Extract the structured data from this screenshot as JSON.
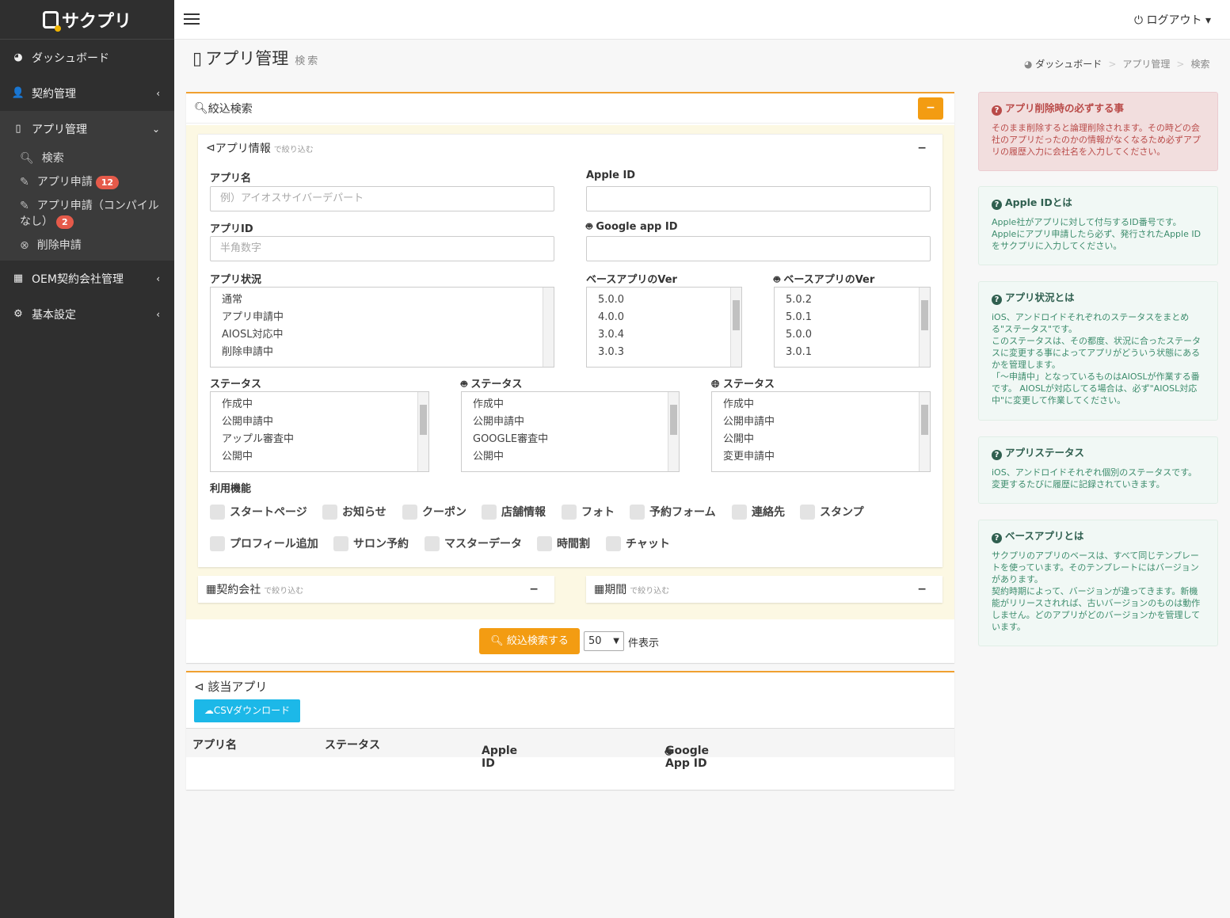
{
  "app": {
    "logo_text": "サクプリ"
  },
  "sidebar": {
    "items": [
      {
        "label": "ダッシュボード",
        "icon": "dashboard-icon"
      },
      {
        "label": "契約管理",
        "icon": "user-icon"
      },
      {
        "label": "アプリ管理",
        "icon": "mobile-icon"
      },
      {
        "label": "OEM契約会社管理",
        "icon": "building-icon"
      },
      {
        "label": "基本設定",
        "icon": "cogs-icon"
      }
    ],
    "sub_items": [
      {
        "label": "検索",
        "icon": "search-icon"
      },
      {
        "label": "アプリ申請",
        "badge": "12",
        "icon": "edit-icon"
      },
      {
        "label": "アプリ申請（コンパイルなし）",
        "badge": "2",
        "icon": "edit-icon"
      },
      {
        "label": "削除申請",
        "icon": "times-circle-icon"
      }
    ]
  },
  "topbar": {
    "logout": "ログアウト"
  },
  "page": {
    "title": "アプリ管理",
    "subtitle": "検索"
  },
  "breadcrumb": [
    "ダッシュボード",
    "アプリ管理",
    "検索"
  ],
  "filter": {
    "title": "絞込検索",
    "app_info": {
      "title": "アプリ情報",
      "hint": "で絞り込む"
    },
    "app_name": {
      "label": "アプリ名",
      "placeholder": "例）アイオスサイバーデパート"
    },
    "apple_id": {
      "label": "Apple ID",
      "value": ""
    },
    "app_id": {
      "label": "アプリID",
      "placeholder": "半角数字"
    },
    "google_id": {
      "label": "Google app ID",
      "value": ""
    },
    "app_status": {
      "label": "アプリ状況",
      "options": [
        "通常",
        "アプリ申請中",
        "AIOSL対応中",
        "削除申請中"
      ]
    },
    "ios_ver": {
      "label": "ベースアプリのVer",
      "options": [
        "5.0.0",
        "4.0.0",
        "3.0.4",
        "3.0.3"
      ]
    },
    "android_ver": {
      "label": "ベースアプリのVer",
      "options": [
        "5.0.2",
        "5.0.1",
        "5.0.0",
        "3.0.1"
      ]
    },
    "ios_status": {
      "label": "ステータス",
      "options": [
        "作成中",
        "公開申請中",
        "アップル審査中",
        "公開中"
      ]
    },
    "android_status": {
      "label": "ステータス",
      "options": [
        "作成中",
        "公開申請中",
        "GOOGLE審査中",
        "公開中"
      ]
    },
    "web_status": {
      "label": "ステータス",
      "options": [
        "作成中",
        "公開申請中",
        "公開中",
        "変更申請中"
      ]
    },
    "features": {
      "label": "利用機能",
      "items": [
        "スタートページ",
        "お知らせ",
        "クーポン",
        "店舗情報",
        "フォト",
        "予約フォーム",
        "連絡先",
        "スタンプ",
        "プロフィール追加",
        "サロン予約",
        "マスターデータ",
        "時間割",
        "チャット"
      ]
    },
    "company": {
      "title": "契約会社",
      "hint": "で絞り込む"
    },
    "period": {
      "title": "期間",
      "hint": "で絞り込む"
    },
    "search_button": "絞込検索する",
    "per_page": "50",
    "per_page_suffix": "件表示"
  },
  "results": {
    "title": "該当アプリ",
    "csv_button": "CSVダウンロード",
    "columns": [
      "アプリ名",
      "ステータス",
      "Apple ID",
      "Google App ID"
    ]
  },
  "info": [
    {
      "title": "アプリ削除時の必ずする事",
      "body": "そのまま削除すると論理削除されます。その時どの会社のアプリだったのかの情報がなくなるため必ずアプリの履歴入力に会社名を入力してください。"
    },
    {
      "title": "Apple IDとは",
      "body": "Apple社がアプリに対して付与するID番号です。Appleにアプリ申請したら必ず、発行されたApple IDをサクプリに入力してください。"
    },
    {
      "title": "アプリ状況とは",
      "body": "iOS、アンドロイドそれぞれのステータスをまとめる\"ステータス\"です。\nこのステータスは、その都度、状況に合ったステータスに変更する事によってアプリがどういう状態にあるかを管理します。\n「～申請中」となっているものはAIOSLが作業する番です。 AIOSLが対応してる場合は、必ず\"AIOSL対応中\"に変更して作業してください。"
    },
    {
      "title": "アプリステータス",
      "body": "iOS、アンドロイドそれぞれ個別のステータスです。変更するたびに履歴に記録されていきます。"
    },
    {
      "title": "ベースアプリとは",
      "body": "サクプリのアプリのベースは、すべて同じテンプレートを使っています。そのテンプレートにはバージョンがあります。\n契約時期によって、バージョンが違ってきます。新機能がリリースされれば、古いバージョンのものは動作しません。どのアプリがどのバージョンかを管理しています。"
    }
  ],
  "colors": {
    "accent": "#f39c12",
    "sidebar": "#2f2f2f",
    "csv": "#1cb8e8",
    "badge": "#e55a4a"
  }
}
